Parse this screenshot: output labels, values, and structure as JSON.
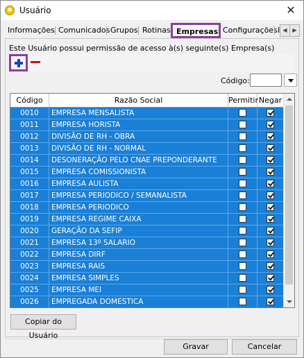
{
  "window": {
    "title": "Usuário",
    "close_glyph": "✕"
  },
  "tabs": [
    {
      "label": "Informações"
    },
    {
      "label": "Comunicados"
    },
    {
      "label": "Grupos"
    },
    {
      "label": "Rotinas"
    },
    {
      "label": "Empresas",
      "active": true
    },
    {
      "label": "Configurações"
    },
    {
      "label": "I"
    }
  ],
  "tab_scroll": {
    "left": "◀",
    "right": "▶"
  },
  "panel": {
    "info_text": "Este Usuário possui permissão de acesso à(s) seguinte(s) Empresa(s)",
    "add_icon": "plus-icon",
    "remove_icon": "minus-icon",
    "codigo_label": "Código:",
    "codigo_value": ""
  },
  "grid": {
    "columns": [
      "Código",
      "Razão Social",
      "Permitir",
      "Negar"
    ],
    "rows": [
      {
        "codigo": "0010",
        "razao": "EMPRESA MENSALISTA",
        "permitir": false,
        "negar": true
      },
      {
        "codigo": "0011",
        "razao": "EMPRESA HORISTA",
        "permitir": false,
        "negar": true
      },
      {
        "codigo": "0012",
        "razao": "DIVISÃO DE RH - OBRA",
        "permitir": false,
        "negar": true
      },
      {
        "codigo": "0013",
        "razao": "DIVISÃO DE RH - NORMAL",
        "permitir": false,
        "negar": true
      },
      {
        "codigo": "0014",
        "razao": "DESONERAÇÃO PELO CNAE PREPONDERANTE",
        "permitir": false,
        "negar": true
      },
      {
        "codigo": "0015",
        "razao": "EMPRESA COMISSIONISTA",
        "permitir": false,
        "negar": true
      },
      {
        "codigo": "0016",
        "razao": "EMPRESA AULISTA",
        "permitir": false,
        "negar": true
      },
      {
        "codigo": "0017",
        "razao": "EMPRESA PERIODICO / SEMANALISTA",
        "permitir": false,
        "negar": true
      },
      {
        "codigo": "0018",
        "razao": "EMPRESA PERIODICO",
        "permitir": false,
        "negar": true
      },
      {
        "codigo": "0019",
        "razao": "EMPRESA REGIME CAIXA",
        "permitir": false,
        "negar": true
      },
      {
        "codigo": "0020",
        "razao": "GERAÇÃO DA SEFIP",
        "permitir": false,
        "negar": true
      },
      {
        "codigo": "0021",
        "razao": "EMPRESA 13º SALARIO",
        "permitir": false,
        "negar": true
      },
      {
        "codigo": "0022",
        "razao": "EMPRESA DIRF",
        "permitir": false,
        "negar": true
      },
      {
        "codigo": "0023",
        "razao": "EMPRESA RAIS",
        "permitir": false,
        "negar": true
      },
      {
        "codigo": "0024",
        "razao": "EMPRESA SIMPLES",
        "permitir": false,
        "negar": true
      },
      {
        "codigo": "0025",
        "razao": "EMPRESA MEI",
        "permitir": false,
        "negar": true
      },
      {
        "codigo": "0026",
        "razao": "EMPREGADA DOMESTICA",
        "permitir": false,
        "negar": true
      }
    ]
  },
  "buttons": {
    "copy_label": "Copiar do Usuário",
    "save_label": "Gravar",
    "cancel_label": "Cancelar"
  }
}
